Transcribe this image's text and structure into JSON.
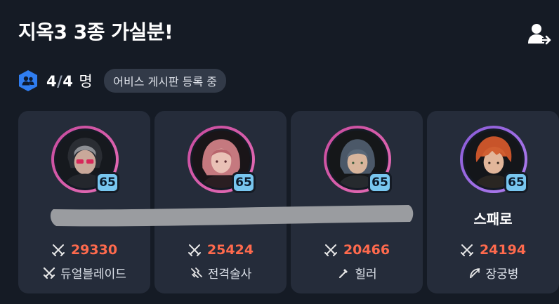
{
  "header": {
    "title": "지옥3 3종 가실분!",
    "leave_icon": "person-exit-icon"
  },
  "party": {
    "current": "4",
    "separator": "/",
    "max": "4",
    "unit": "명",
    "status": "어비스 게시판 등록 중"
  },
  "members": [
    {
      "level": "65",
      "name": "",
      "power": "29330",
      "class": "듀얼블레이드",
      "class_icon": "dual-blade-icon",
      "leader": true,
      "ring": "#d458a8"
    },
    {
      "level": "65",
      "name": "",
      "power": "25424",
      "class": "전격술사",
      "class_icon": "lightning-icon",
      "leader": false,
      "ring": "#d458a8"
    },
    {
      "level": "65",
      "name": "",
      "power": "20466",
      "class": "힐러",
      "class_icon": "staff-icon",
      "leader": false,
      "ring": "#d458a8"
    },
    {
      "level": "65",
      "name": "스패로",
      "power": "24194",
      "class": "장궁병",
      "class_icon": "bow-icon",
      "leader": false,
      "ring": "#9a66e0"
    }
  ],
  "colors": {
    "background": "#151b25",
    "card": "#252c3a",
    "power": "#ff6a4d",
    "level_badge": "#78c6ef",
    "party_icon": "#2f7df0",
    "crown": "#f2c12e"
  }
}
